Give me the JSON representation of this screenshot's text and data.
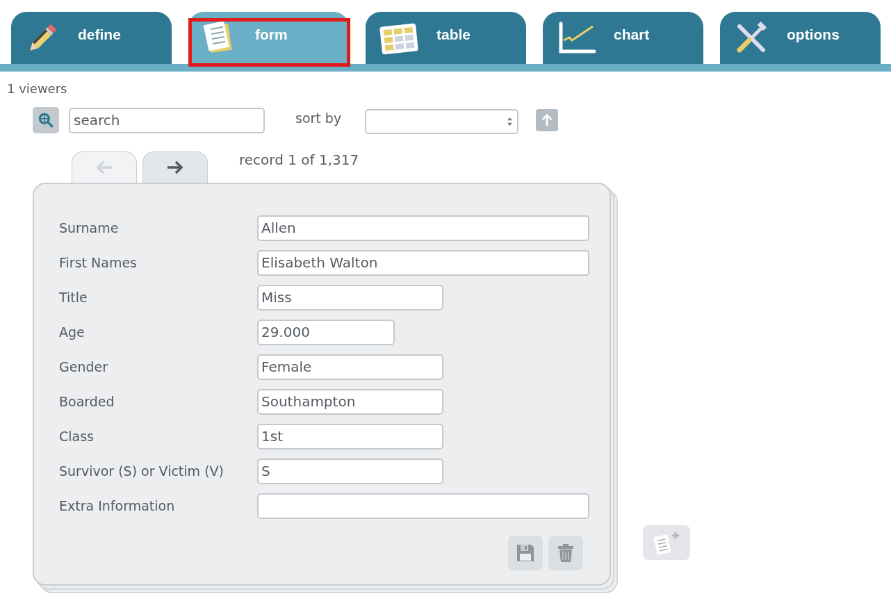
{
  "tabs": [
    {
      "label": "define",
      "kind": "pencil",
      "selected": false,
      "highlighted": false
    },
    {
      "label": "form",
      "kind": "form",
      "selected": true,
      "highlighted": true
    },
    {
      "label": "table",
      "kind": "table",
      "selected": false,
      "highlighted": false
    },
    {
      "label": "chart",
      "kind": "chart",
      "selected": false,
      "highlighted": false
    },
    {
      "label": "options",
      "kind": "tools",
      "selected": false,
      "highlighted": false
    }
  ],
  "viewers": "1 viewers",
  "search": {
    "placeholder": "search"
  },
  "sort": {
    "label": "sort by"
  },
  "nav": {
    "prev_disabled": true,
    "next_disabled": false,
    "record": "record 1 of 1,317"
  },
  "fields": [
    {
      "label": "Surname",
      "value": "Allen",
      "kind": "wide"
    },
    {
      "label": "First Names",
      "value": "Elisabeth Walton",
      "kind": "wide"
    },
    {
      "label": "Title",
      "value": "Miss",
      "kind": "medium"
    },
    {
      "label": "Age",
      "value": "29.000",
      "kind": "small"
    },
    {
      "label": "Gender",
      "value": "Female",
      "kind": "medium"
    },
    {
      "label": "Boarded",
      "value": "Southampton",
      "kind": "medium"
    },
    {
      "label": "Class",
      "value": "1st",
      "kind": "medium"
    },
    {
      "label": "Survivor (S) or Victim (V)",
      "value": "S",
      "kind": "medium"
    },
    {
      "label": "Extra Information",
      "kind": "wide"
    }
  ]
}
